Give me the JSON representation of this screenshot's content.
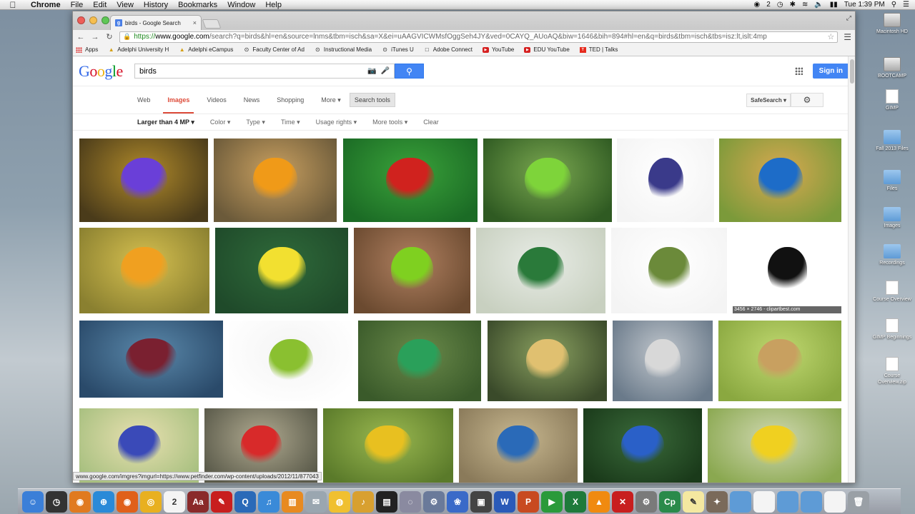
{
  "menubar": {
    "app": "Chrome",
    "menus": [
      "File",
      "Edit",
      "View",
      "History",
      "Bookmarks",
      "Window",
      "Help"
    ],
    "status_count": "2",
    "clock": "Tue 1:39 PM"
  },
  "browser": {
    "tab_title": "birds - Google Search",
    "url_https": "https://",
    "url_domain": "www.google.com",
    "url_rest": "/search?q=birds&hl=en&source=lnms&tbm=isch&sa=X&ei=uAAGVICWMsfOggSeh4JY&ved=0CAYQ_AUoAQ&biw=1646&bih=894#hl=en&q=birds&tbm=isch&tbs=isz:lt,islt:4mp",
    "bookmarks": [
      "Apps",
      "Adelphi University H",
      "Adelphi eCampus",
      "Faculty Center of Ad",
      "Instructional Media",
      "iTunes U",
      "Adobe Connect",
      "YouTube",
      "EDU YouTube",
      "TED | Talks"
    ],
    "status_url": "www.google.com/imgres?imgurl=https://www.petfinder.com/wp-content/uploads/2012/11/877043"
  },
  "google": {
    "logo": [
      "G",
      "o",
      "o",
      "g",
      "l",
      "e"
    ],
    "logo_colors": [
      "#3369e8",
      "#d50f25",
      "#eeb211",
      "#3369e8",
      "#009925",
      "#d50f25"
    ],
    "query": "birds",
    "signin": "Sign in",
    "tabs": [
      "Web",
      "Images",
      "Videos",
      "News",
      "Shopping",
      "More ▾"
    ],
    "search_tools": "Search tools",
    "safesearch": "SafeSearch ▾",
    "subtools": [
      "Larger than 4 MP ▾",
      "Color ▾",
      "Type ▾",
      "Time ▾",
      "Usage rights ▾",
      "More tools ▾",
      "Clear"
    ],
    "image_size_label": "3456 × 2746 - clipartbest.com"
  },
  "desktop": {
    "icons": [
      "Macintosh HD",
      "BOOTCAMP",
      "GIMP",
      "Fall 2013 Files",
      "Files",
      "Images",
      "Recordings",
      "Course Overview",
      "GIMP Beginnings",
      "Course Overview.zip"
    ]
  },
  "colors": {
    "google_blue": "#4285f4",
    "active_tab_red": "#dd4b39"
  }
}
